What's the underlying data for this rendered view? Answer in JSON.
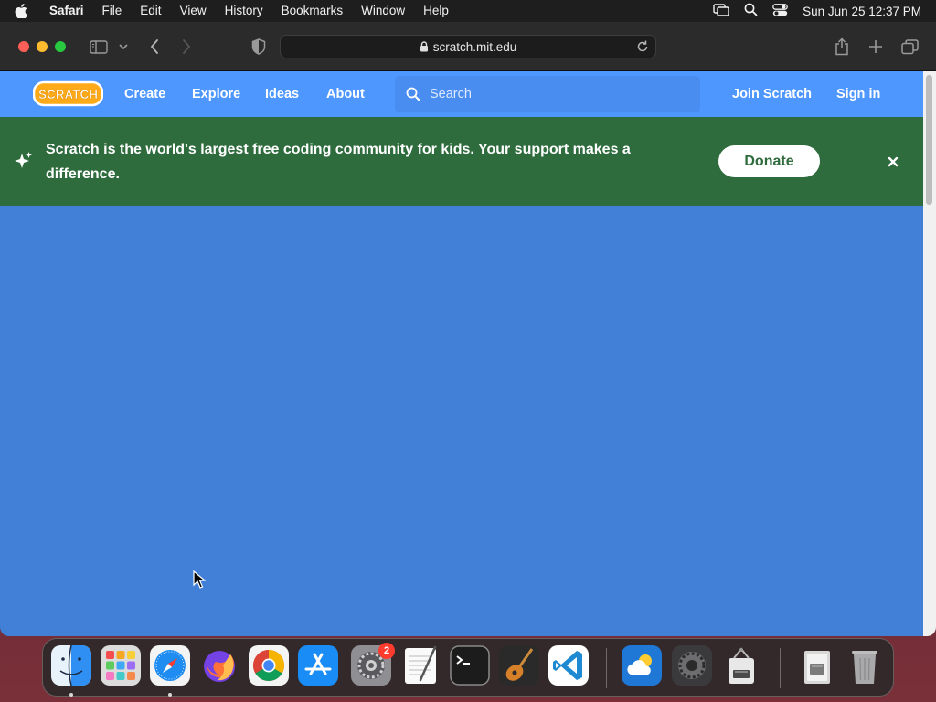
{
  "menubar": {
    "app_name": "Safari",
    "items": [
      "File",
      "Edit",
      "View",
      "History",
      "Bookmarks",
      "Window",
      "Help"
    ],
    "clock": "Sun Jun 25  12:37 PM"
  },
  "browser": {
    "url": "scratch.mit.edu"
  },
  "scratch_nav": {
    "logo_text": "SCRATCH",
    "links": [
      "Create",
      "Explore",
      "Ideas",
      "About"
    ],
    "search_placeholder": "Search",
    "join_label": "Join Scratch",
    "signin_label": "Sign in"
  },
  "banner": {
    "message": "Scratch is the world's largest free coding community for kids. Your support makes a difference.",
    "donate_label": "Donate",
    "color": "#2e6b3d"
  },
  "colors": {
    "nav_blue": "#4d97ff",
    "content_blue": "#4280d7"
  },
  "dock": {
    "apps": [
      {
        "name": "Finder",
        "icon": "finder-icon",
        "running": true
      },
      {
        "name": "Launchpad",
        "icon": "launchpad-icon",
        "running": false
      },
      {
        "name": "Safari",
        "icon": "safari-icon",
        "running": true
      },
      {
        "name": "Firefox",
        "icon": "firefox-icon",
        "running": false
      },
      {
        "name": "Chrome",
        "icon": "chrome-icon",
        "running": false
      },
      {
        "name": "App Store",
        "icon": "app-store-icon",
        "running": false
      },
      {
        "name": "System Settings",
        "icon": "system-settings-icon",
        "running": false,
        "badge": "2"
      },
      {
        "name": "TextEdit",
        "icon": "textedit-icon",
        "running": false
      },
      {
        "name": "Terminal",
        "icon": "terminal-icon",
        "running": false
      },
      {
        "name": "GarageBand",
        "icon": "garageband-icon",
        "running": false
      },
      {
        "name": "VS Code",
        "icon": "vscode-icon",
        "running": false
      },
      {
        "name": "Weather",
        "icon": "weather-icon",
        "running": false
      },
      {
        "name": "Compressor",
        "icon": "compressor-icon",
        "running": false
      },
      {
        "name": "Archive Utility",
        "icon": "archive-icon",
        "running": false
      },
      {
        "name": "Downloads",
        "icon": "downloads-folder-icon",
        "running": false
      },
      {
        "name": "Trash",
        "icon": "trash-icon",
        "running": false
      }
    ]
  }
}
